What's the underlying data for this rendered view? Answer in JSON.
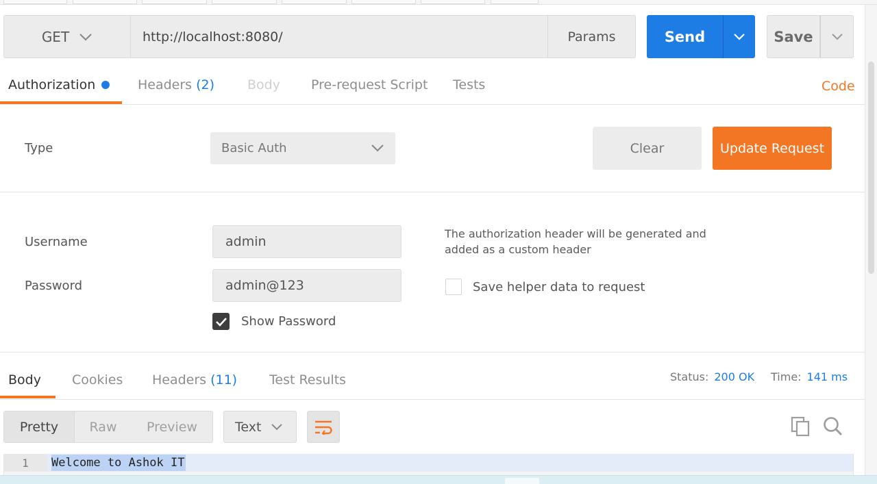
{
  "request": {
    "method": "GET",
    "url": "http://localhost:8080/",
    "params_label": "Params",
    "send_label": "Send",
    "save_label": "Save"
  },
  "request_tabs": {
    "authorization": "Authorization",
    "headers": "Headers",
    "headers_count": "(2)",
    "body": "Body",
    "prerequest": "Pre-request Script",
    "tests": "Tests",
    "code": "Code"
  },
  "auth": {
    "type_label": "Type",
    "type_value": "Basic Auth",
    "clear_label": "Clear",
    "update_label": "Update Request",
    "username_label": "Username",
    "username_value": "admin",
    "password_label": "Password",
    "password_value": "admin@123",
    "show_password_label": "Show Password",
    "show_password_checked": true,
    "helper_text": "The authorization header will be generated and added as a custom header",
    "save_helper_label": "Save helper data to request",
    "save_helper_checked": false
  },
  "response_tabs": {
    "body": "Body",
    "cookies": "Cookies",
    "headers": "Headers",
    "headers_count": "(11)",
    "test_results": "Test Results"
  },
  "status": {
    "status_label": "Status:",
    "status_value": "200 OK",
    "time_label": "Time:",
    "time_value": "141 ms"
  },
  "response_view": {
    "pretty": "Pretty",
    "raw": "Raw",
    "preview": "Preview",
    "format": "Text"
  },
  "response_body": {
    "line_number": "1",
    "line_text": "Welcome to Ashok IT"
  },
  "colors": {
    "accent_orange": "#f37625",
    "send_blue": "#1e7de5",
    "dot_blue": "#1e7de5"
  }
}
